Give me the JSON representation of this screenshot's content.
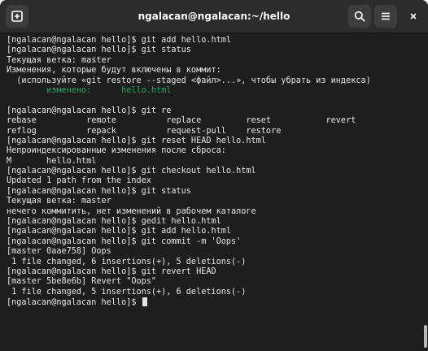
{
  "window": {
    "title": "ngalacan@ngalacan:~/hello"
  },
  "icons": {
    "new_tab": "new-tab-plus-icon",
    "search": "search-icon",
    "menu": "hamburger-menu-icon",
    "close": "close-icon"
  },
  "terminal": {
    "lines": [
      "[ngalacan@ngalacan hello]$ git add hello.html",
      "[ngalacan@ngalacan hello]$ git status",
      "Текущая ветка: master",
      "Изменения, которые будут включены в коммит:",
      "  (используйте «git restore --staged <файл>...», чтобы убрать из индекса)",
      "        изменено:      hello.html",
      "",
      "[ngalacan@ngalacan hello]$ git re",
      "rebase          remote          replace         reset           revert",
      "reflog          repack          request-pull    restore",
      "[ngalacan@ngalacan hello]$ git reset HEAD hello.html",
      "Непроиндексированные изменения после сброса:",
      "M       hello.html",
      "[ngalacan@ngalacan hello]$ git checkout hello.html",
      "Updated 1 path from the index",
      "[ngalacan@ngalacan hello]$ git status",
      "Текущая ветка: master",
      "нечего коммитить, нет изменений в рабочем каталоге",
      "[ngalacan@ngalacan hello]$ gedit hello.html",
      "[ngalacan@ngalacan hello]$ git add hello.html",
      "[ngalacan@ngalacan hello]$ git commit -m 'Oops'",
      "[master 0aae758] Oops",
      " 1 file changed, 6 insertions(+), 5 deletions(-)",
      "[ngalacan@ngalacan hello]$ git revert HEAD",
      "[master 5be8e6b] Revert \"Oops\"",
      " 1 file changed, 5 insertions(+), 6 deletions(-)",
      "[ngalacan@ngalacan hello]$ "
    ]
  },
  "colors": {
    "background": "#1e1e1e",
    "titlebar": "#2c2c2c",
    "text": "#e6e6e6",
    "staged_green": "#26a269"
  }
}
